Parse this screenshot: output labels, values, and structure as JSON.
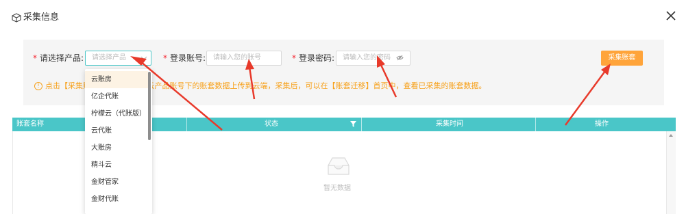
{
  "dialog": {
    "title": "采集信息",
    "icons": {
      "title": "box-icon",
      "close": "close-icon"
    }
  },
  "form": {
    "required_mark": "*",
    "product_label": "请选择产品:",
    "product_placeholder": "请选择产品",
    "account_label": "登录账号:",
    "account_placeholder": "请输入您的账号",
    "password_label": "登录密码:",
    "password_placeholder": "请输入您的密码",
    "collect_button": "采集账套",
    "notice_icon": "!",
    "notice_text": "点击【采集账套】，将账套对应云产品账号下的账套数据上传到云端，采集后，可以在【账套迁移】首页中，查看已采集的账套数据。"
  },
  "dropdown": {
    "items": [
      "云账房",
      "亿企代账",
      "柠檬云（代账版）",
      "云代账",
      "大账房",
      "精斗云",
      "金财管家",
      "金财代账"
    ],
    "active_index": 0
  },
  "table": {
    "columns": [
      "账套名称",
      "状态",
      "采集时间",
      "操作"
    ],
    "empty_text": "暂无数据"
  },
  "colors": {
    "accent": "#4ac6c8",
    "button": "#ffa43a",
    "notice": "#f7a11b",
    "annotation": "#e83a2b"
  }
}
